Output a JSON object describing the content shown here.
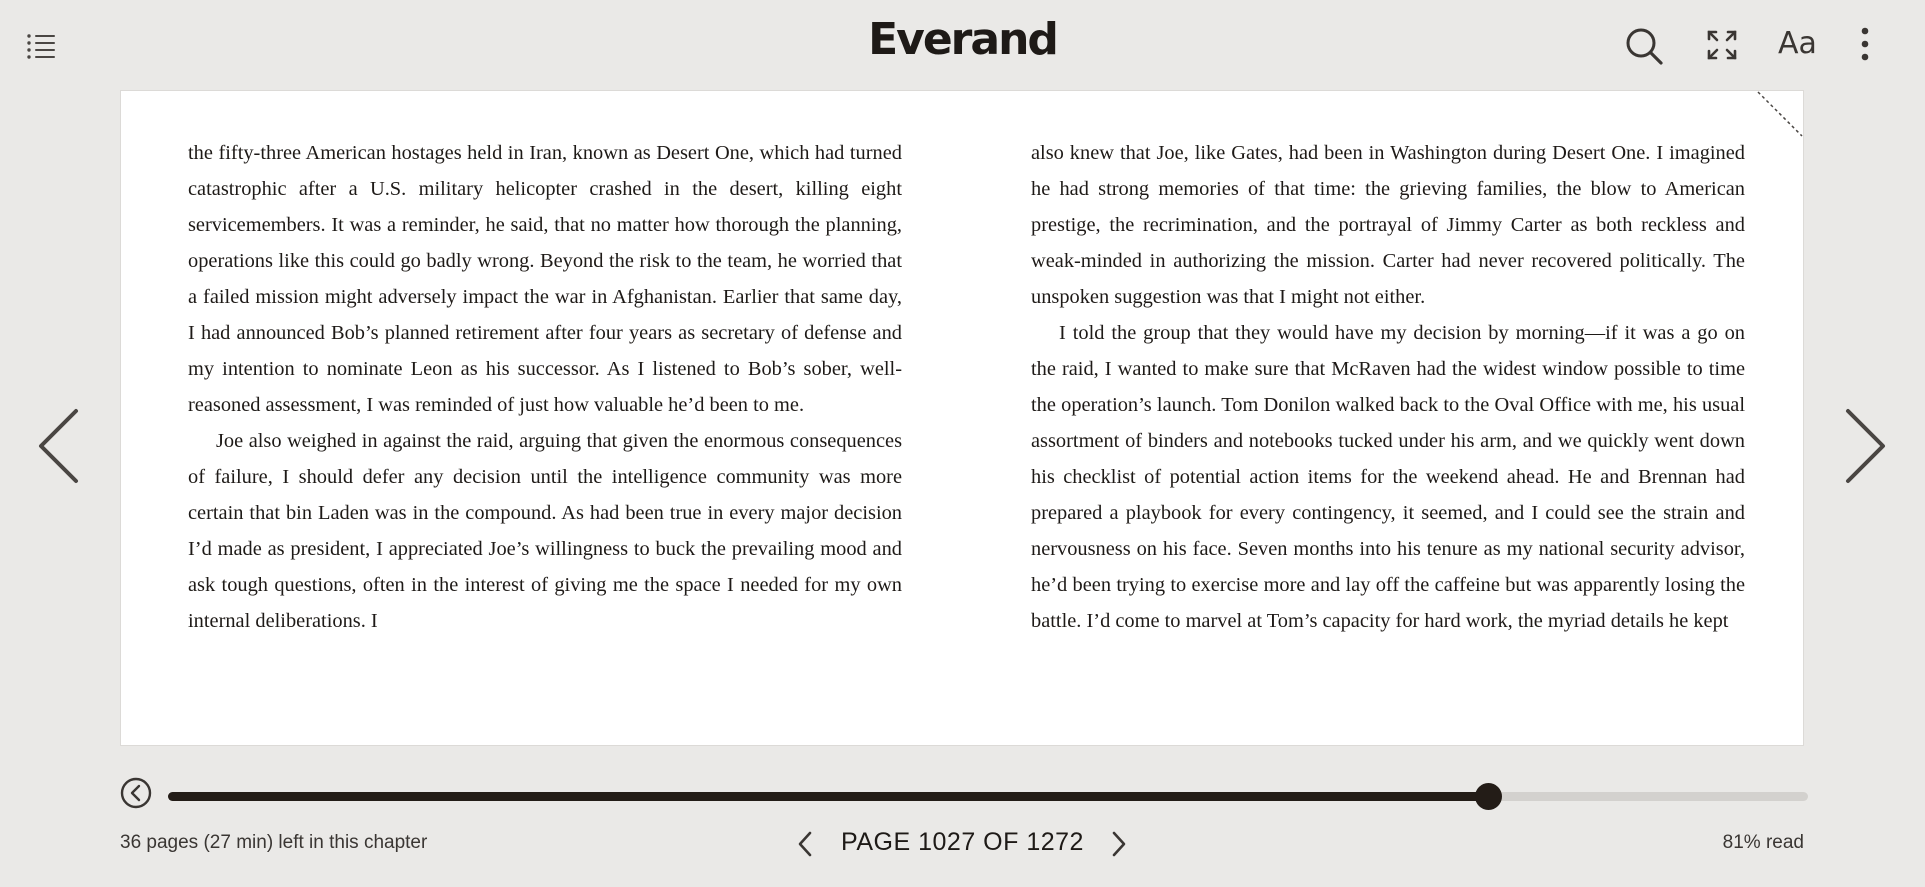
{
  "header": {
    "logo": "Everand",
    "icons": [
      "list-icon",
      "search-icon",
      "fullscreen-icon",
      "font-settings-icon",
      "more-vertical-icon"
    ],
    "font_button_label": "Aa"
  },
  "reader": {
    "left_column": [
      "the fifty-three American hostages held in Iran, known as Desert One, which had turned catastrophic after a U.S. military helicopter crashed in the desert, killing eight servicemembers. It was a reminder, he said, that no matter how thorough the planning, operations like this could go badly wrong. Beyond the risk to the team, he worried that a failed mission might adversely impact the war in Afghanistan. Earlier that same day, I had announced Bob’s planned retirement after four years as secretary of defense and my intention to nominate Leon as his successor. As I listened to Bob’s sober, well-reasoned assessment, I was reminded of just how valuable he’d been to me.",
      "Joe also weighed in against the raid, arguing that given the enormous consequences of failure, I should defer any decision until the intelligence community was more certain that bin Laden was in the compound. As had been true in every major decision I’d made as president, I appreciated Joe’s willingness to buck the prevailing mood and ask tough questions, often in the interest of giving me the space I needed for my own internal deliberations. I"
    ],
    "right_column": [
      "also knew that Joe, like Gates, had been in Washington during Desert One. I imagined he had strong memories of that time: the grieving families, the blow to American prestige, the recrimination, and the portrayal of Jimmy Carter as both reckless and weak-minded in authorizing the mission. Carter had never recovered politically. The unspoken suggestion was that I might not either.",
      "I told the group that they would have my decision by morning—if it was a go on the raid, I wanted to make sure that McRaven had the widest window possible to time the operation’s launch. Tom Donilon walked back to the Oval Office with me, his usual assortment of binders and notebooks tucked under his arm, and we quickly went down his checklist of potential action items for the weekend ahead. He and Brennan had prepared a playbook for every contin­gency, it seemed, and I could see the strain and nervousness on his face. Seven months into his tenure as my national security advisor, he’d been trying to exercise more and lay off the caffeine but was apparently losing the battle. I’d come to marvel at Tom’s capacity for hard work, the myriad details he kept"
    ]
  },
  "footer": {
    "chapter_left": "36 pages (27 min) left in this chapter",
    "page_label": "PAGE 1027 OF 1272",
    "read_label": "81% read",
    "progress": 0.805
  },
  "colors": {
    "background": "#eae9e7",
    "page": "#ffffff",
    "text": "#1e1a17",
    "progress_fill": "#231c17",
    "progress_track": "#d3d1ce"
  }
}
